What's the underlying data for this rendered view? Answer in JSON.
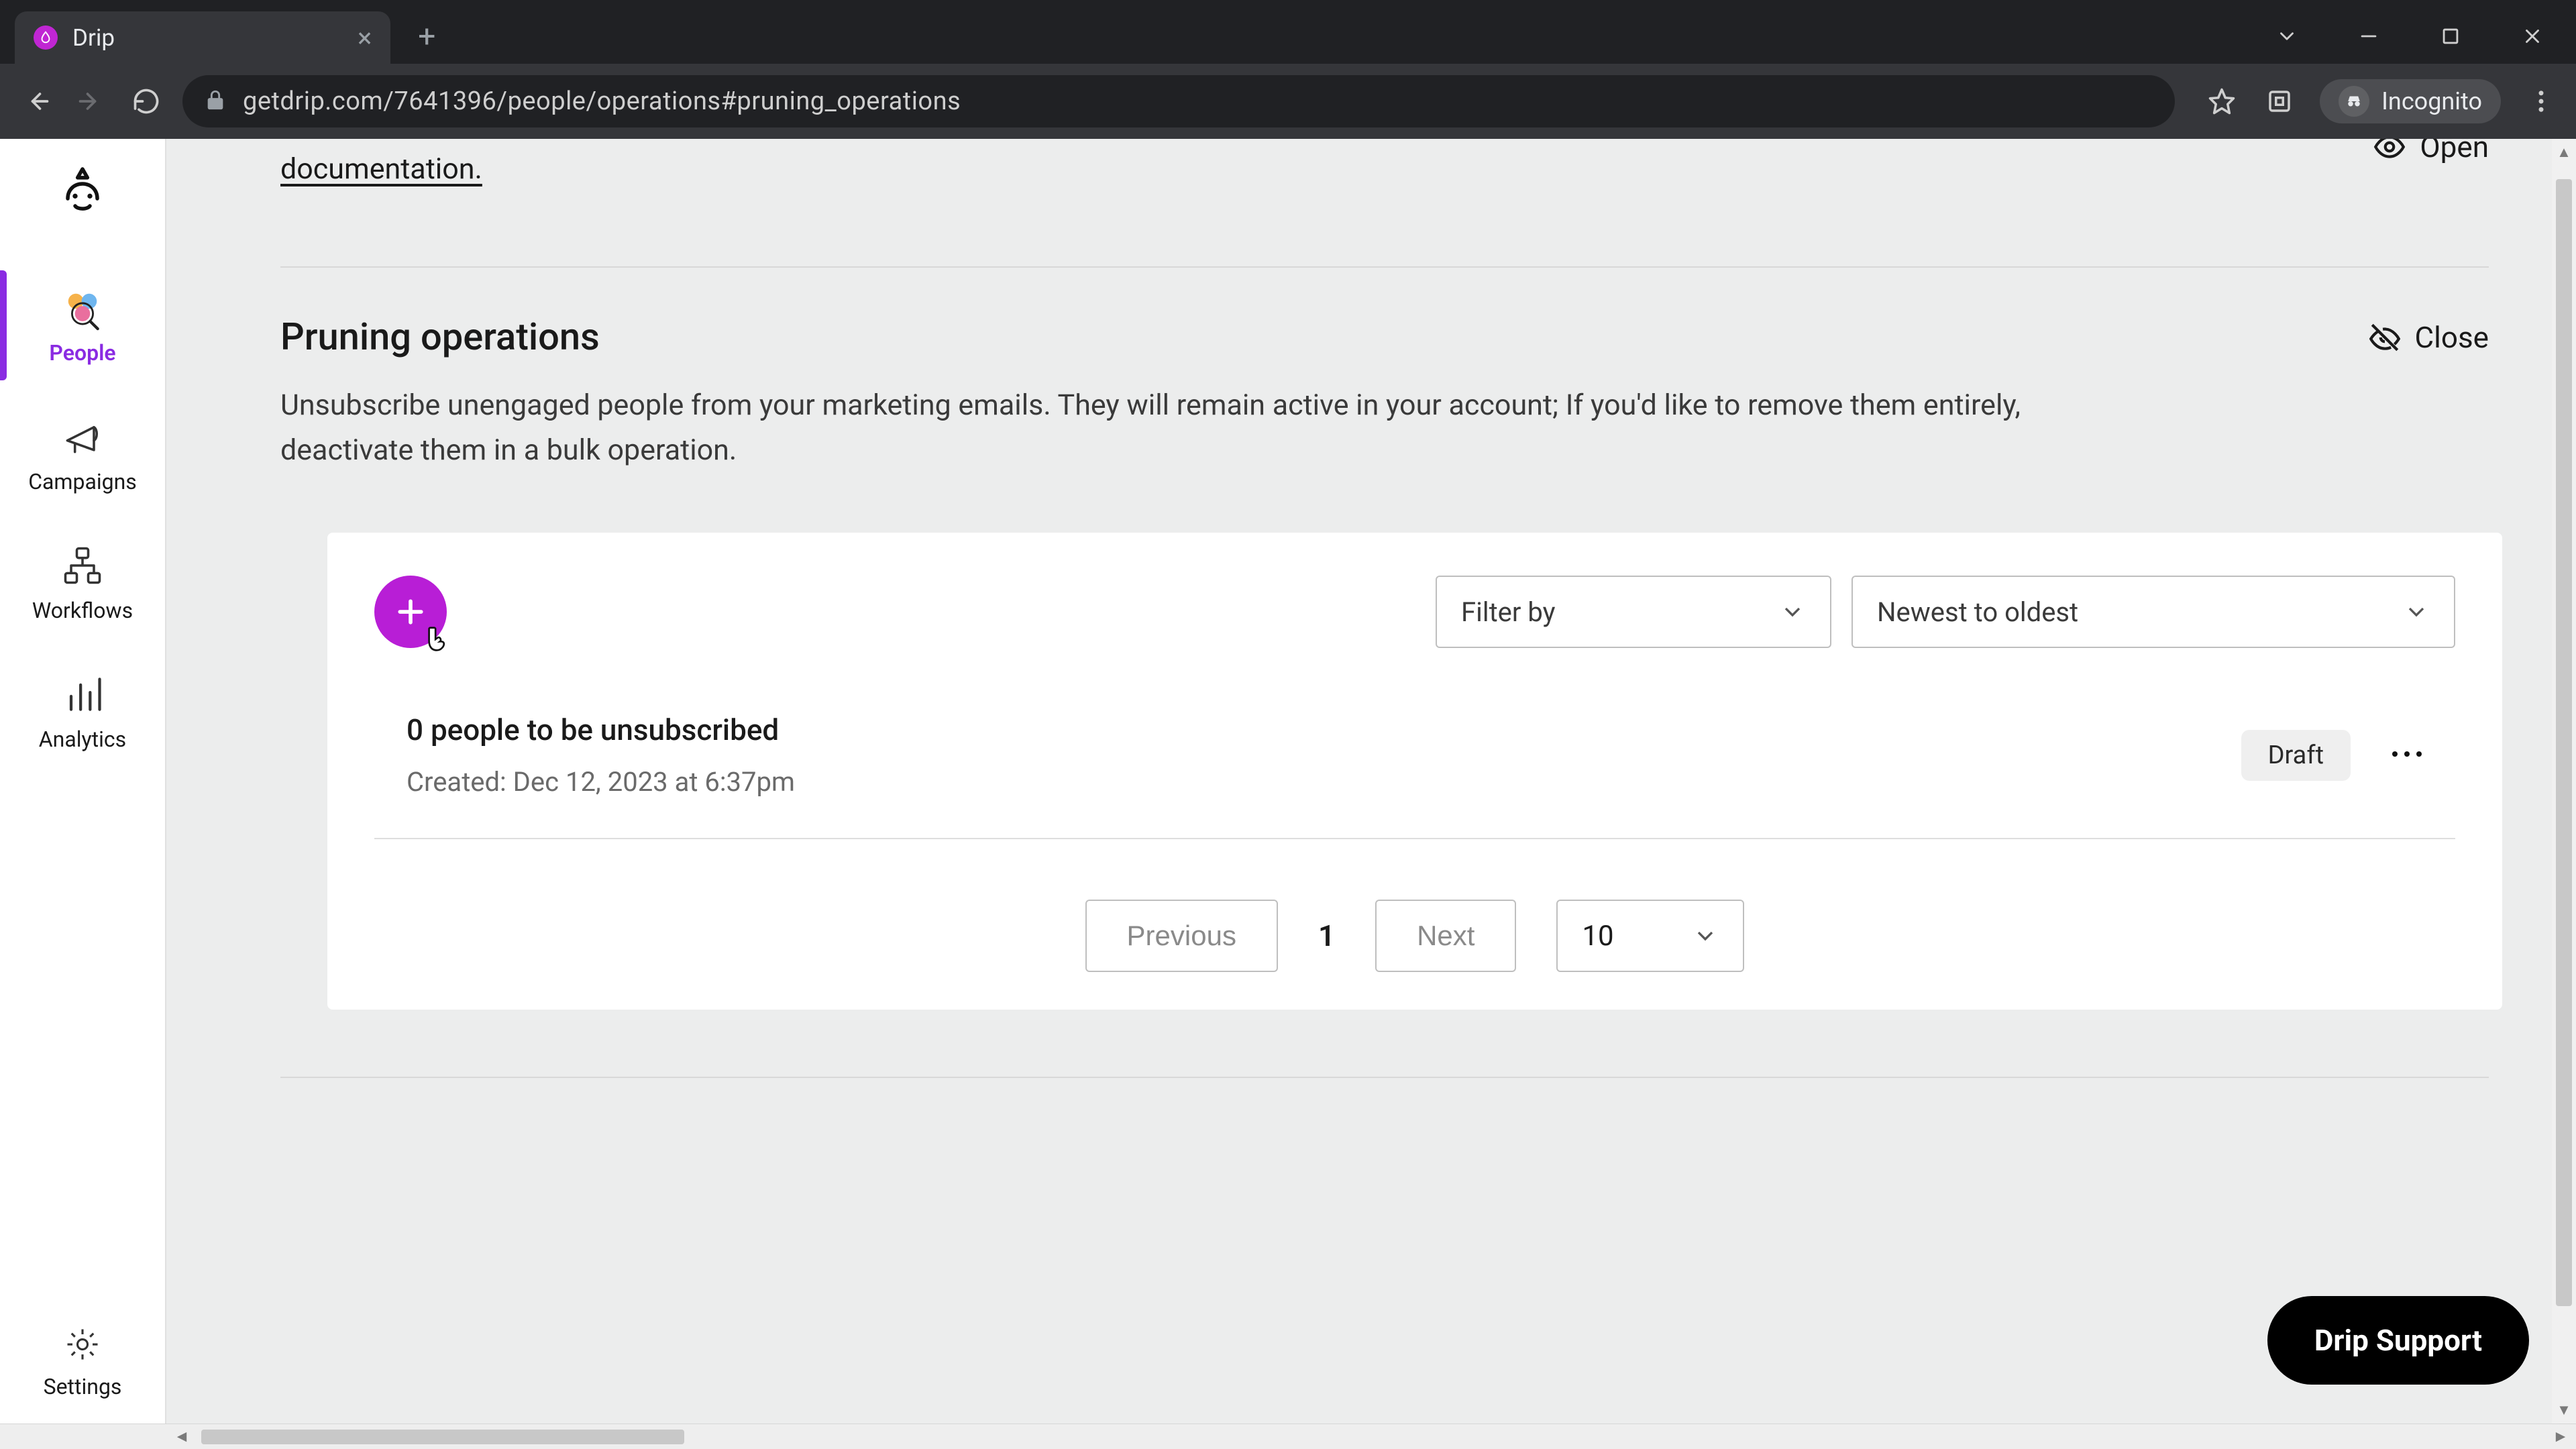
{
  "browser": {
    "tab_title": "Drip",
    "url": "getdrip.com/7641396/people/operations#pruning_operations",
    "incognito_label": "Incognito"
  },
  "sidebar": {
    "items": [
      {
        "label": "People"
      },
      {
        "label": "Campaigns"
      },
      {
        "label": "Workflows"
      },
      {
        "label": "Analytics"
      }
    ],
    "settings_label": "Settings"
  },
  "header": {
    "doc_link_text": "documentation.",
    "open_label": "Open"
  },
  "section": {
    "title": "Pruning operations",
    "description": "Unsubscribe unengaged people from your marketing emails. They will remain active in your account; If you'd like to remove them entirely, deactivate them in a bulk operation.",
    "close_label": "Close"
  },
  "filters": {
    "filter_placeholder": "Filter by",
    "sort_value": "Newest to oldest"
  },
  "operation": {
    "title": "0 people to be unsubscribed",
    "created": "Created: Dec 12, 2023 at 6:37pm",
    "badge": "Draft"
  },
  "pagination": {
    "prev_label": "Previous",
    "next_label": "Next",
    "current_page": "1",
    "page_size": "10"
  },
  "support": {
    "label": "Drip Support"
  }
}
